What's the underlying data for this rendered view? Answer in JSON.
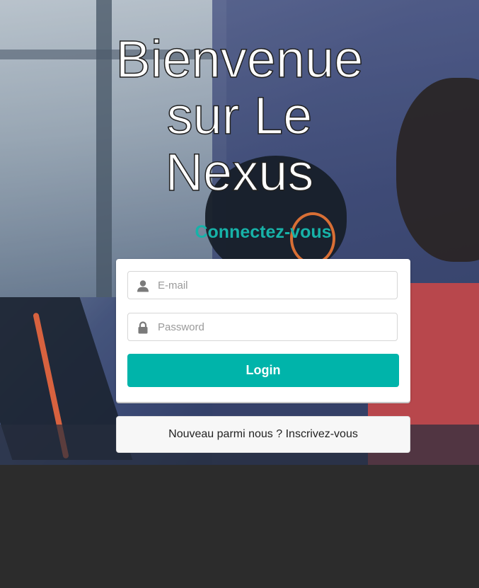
{
  "hero": {
    "title_lines": [
      "Bienvenue",
      "sur Le",
      "Nexus"
    ],
    "subtitle": "Connectez-vous"
  },
  "login_form": {
    "email": {
      "value": "",
      "placeholder": "E-mail",
      "icon": "user-icon"
    },
    "password": {
      "value": "",
      "placeholder": "Password",
      "icon": "lock-icon"
    },
    "submit_label": "Login"
  },
  "register": {
    "prompt": "Nouveau parmi nous ?",
    "link_label": "Inscrivez-vous"
  },
  "colors": {
    "accent": "#00b4aa",
    "subtitle": "#17b2a8",
    "footer_bg": "#2c2c2c",
    "card_bg": "#ffffff",
    "register_bg": "#f7f7f7"
  }
}
